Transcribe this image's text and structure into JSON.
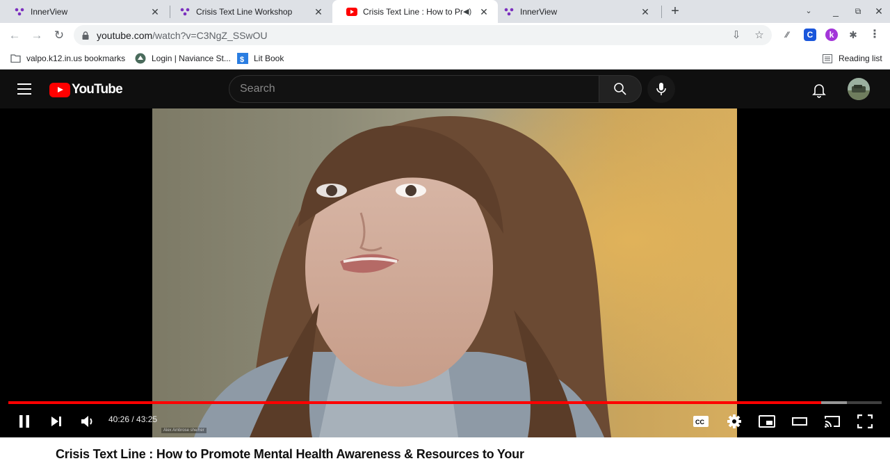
{
  "browser": {
    "tabs": [
      {
        "label": "InnerView",
        "favicon": "innerview-icon",
        "active": false
      },
      {
        "label": "Crisis Text Line Workshop",
        "favicon": "innerview-icon",
        "active": false
      },
      {
        "label": "Crisis Text Line : How to Pro",
        "favicon": "youtube-icon",
        "active": true,
        "audio": true
      },
      {
        "label": "InnerView",
        "favicon": "innerview-icon",
        "active": false
      }
    ],
    "url_host": "youtube.com",
    "url_path": "/watch?v=C3NgZ_SSwOU",
    "bookmarks": [
      {
        "label": "valpo.k12.in.us bookmarks",
        "icon": "folder-icon"
      },
      {
        "label": "Login | Naviance St...",
        "icon": "naviance-icon"
      },
      {
        "label": "Lit Book",
        "icon": "litbook-icon"
      }
    ],
    "reading_list": "Reading list"
  },
  "youtube": {
    "logo_text": "YouTube",
    "search_placeholder": "Search"
  },
  "player": {
    "current_time": "40:26",
    "duration": "43:25",
    "time_display": "40:26 / 43:25",
    "played_fraction": 0.931,
    "buffered_fraction": 0.96,
    "speaker_caption": "Alex Ambrose she/her",
    "cc_label": "CC"
  },
  "video": {
    "title": "Crisis Text Line : How to Promote Mental Health Awareness & Resources to Your"
  },
  "colors": {
    "youtube_red": "#ff0000",
    "header_bg": "#0f0f0f",
    "tabstrip_bg": "#dee1e6",
    "innerview_purple": "#7b2fbe"
  }
}
